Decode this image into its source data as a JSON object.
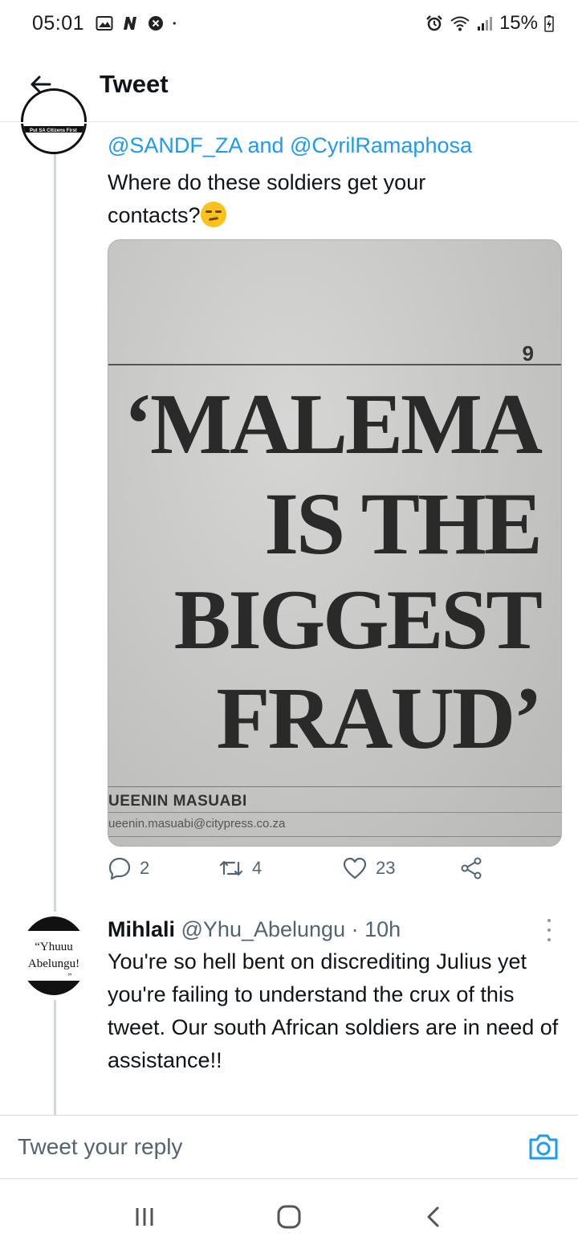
{
  "status_bar": {
    "time": "05:01",
    "battery": "15%",
    "left_icons": [
      "gallery-icon",
      "n-icon",
      "close-circle-icon",
      "dot-icon"
    ],
    "right_icons": [
      "alarm-icon",
      "wifi-icon",
      "signal-icon",
      "battery-charging-icon"
    ]
  },
  "app_bar": {
    "title": "Tweet",
    "back_icon": "arrow-left-icon"
  },
  "tweet": {
    "avatar_text": "Put SA Citizens First",
    "mention_line_parts": [
      "@SANDF_ZA",
      " and ",
      "@CyrilRamaphosa"
    ],
    "text": "Where do these soldiers get your contacts?",
    "emoji": "smirking-face",
    "image": {
      "page_number": "9",
      "headline_lines": [
        "‘MALEMA",
        "IS THE",
        "BIGGEST",
        "FRAUD’"
      ],
      "byline": "UEENIN MASUABI",
      "byline_email": "ueenin.masuabi@citypress.co.za"
    },
    "actions": {
      "replies": "2",
      "retweets": "4",
      "likes": "23"
    }
  },
  "reply": {
    "avatar_lines": [
      "“Yhuuu",
      "Abelungu!",
      "”"
    ],
    "name": "Mihlali",
    "handle_time": " @Yhu_Abelungu · 10h",
    "text": "You're so hell bent on discrediting Julius yet you're failing to understand the crux of this tweet. Our south African soldiers are in need of assistance!!"
  },
  "composer": {
    "placeholder": "Tweet your reply"
  },
  "nav_bar": {
    "buttons": [
      "recent-apps-icon",
      "home-icon",
      "back-icon"
    ]
  },
  "colors": {
    "accent": "#1d9bf0",
    "text": "#0f1419",
    "muted": "#536471",
    "thread_line": "#cfd9de"
  }
}
